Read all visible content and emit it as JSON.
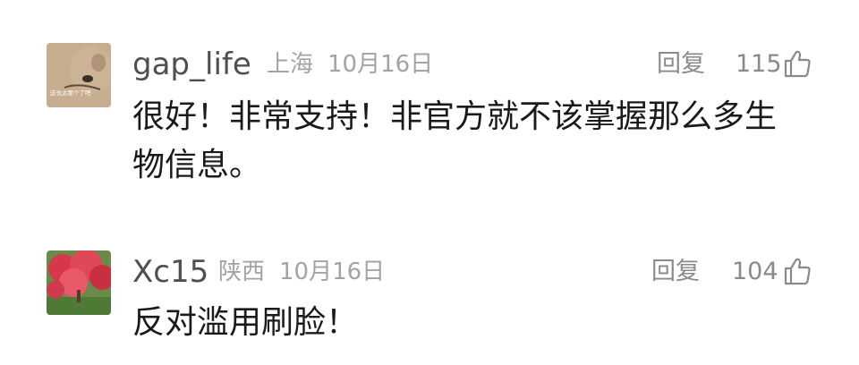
{
  "comments": [
    {
      "username": "gap_life",
      "location": "上海",
      "date": "10月16日",
      "reply_label": "回复",
      "likes": "115",
      "avatar_caption": "这也太那个了吧",
      "text_line1": "很好！非常支持！非官方就不该掌握那么多生",
      "text_line2": "物信息。"
    },
    {
      "username": "Xc15",
      "location": "陕西",
      "date": "10月16日",
      "reply_label": "回复",
      "likes": "104",
      "text_line1": "反对滥用刷脸！"
    }
  ],
  "colors": {
    "username": "#4f4f4f",
    "meta": "#a3a3a3",
    "action": "#8a8a8a",
    "text": "#1a1a1a"
  },
  "icons": {
    "like": "thumbs-up-icon"
  }
}
